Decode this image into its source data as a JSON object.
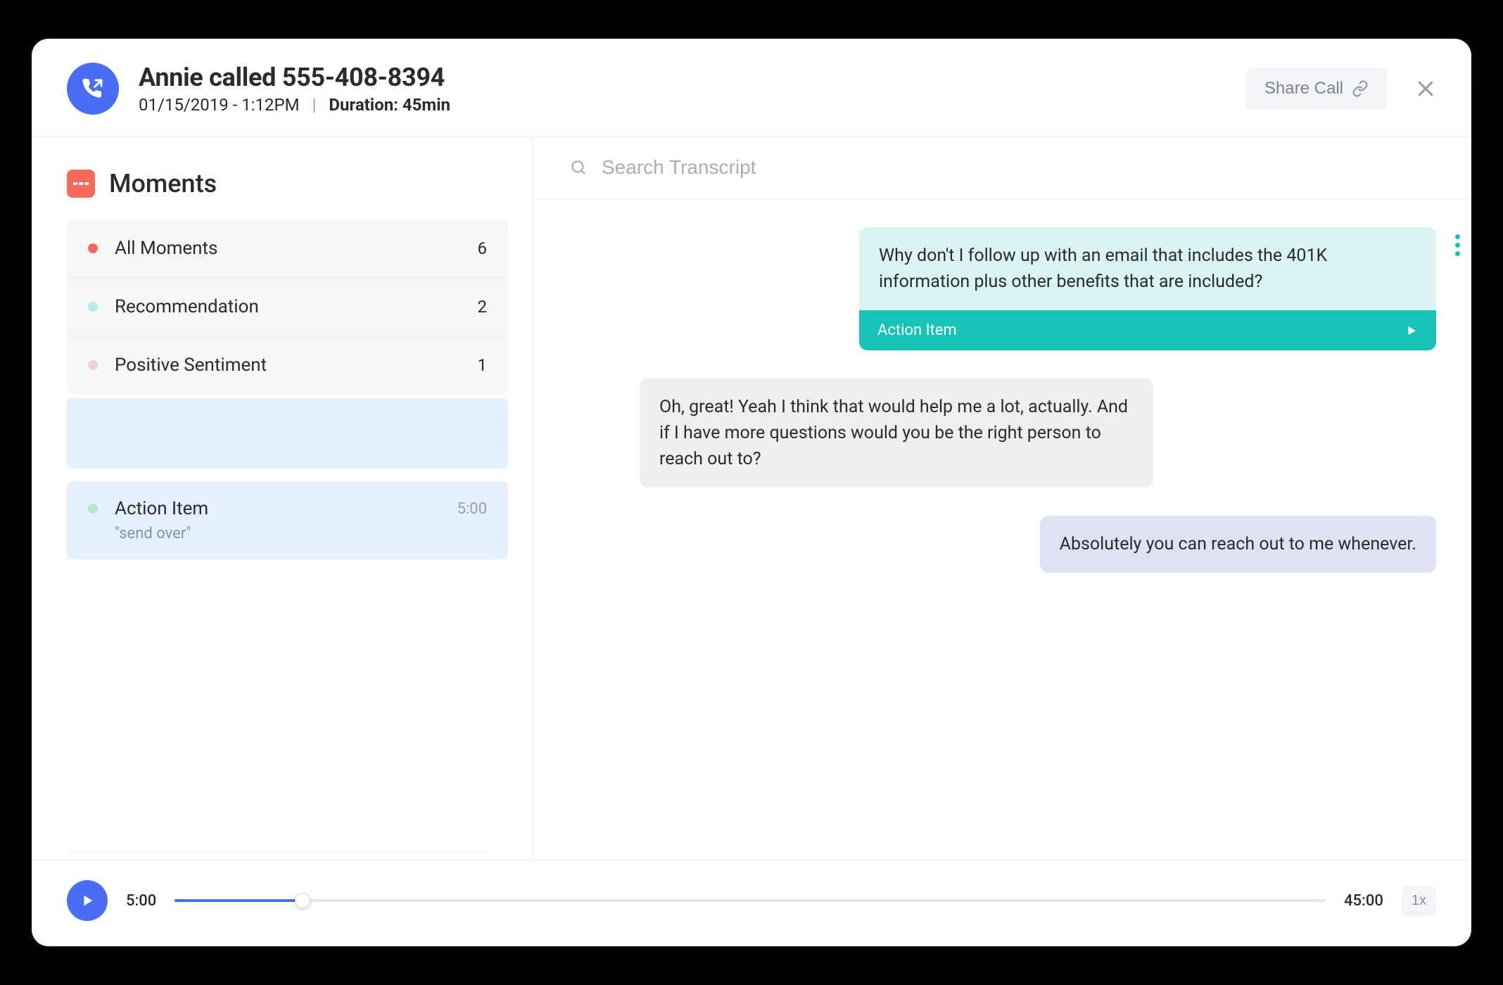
{
  "header": {
    "title": "Annie called 555-408-8394",
    "date": "01/15/2019 - 1:12PM",
    "duration_label": "Duration:",
    "duration_value": "45min",
    "share_label": "Share Call"
  },
  "sidebar": {
    "title": "Moments",
    "filters": [
      {
        "label": "All Moments",
        "count": "6",
        "color": "#f96a5d"
      },
      {
        "label": "Recommendation",
        "count": "2",
        "color": "#b9e9e6"
      },
      {
        "label": "Positive Sentiment",
        "count": "1",
        "color": "#f9cfe0"
      }
    ],
    "moment": {
      "dot_color": "#b6e6c8",
      "label": "Action Item",
      "time": "5:00",
      "snippet": "\"send over\""
    }
  },
  "search": {
    "placeholder": "Search Transcript"
  },
  "transcript": {
    "msg1": "Why don't I follow up with an email that includes the 401K information plus other benefits that are included?",
    "msg1_tag": "Action Item",
    "msg2": "Oh, great! Yeah I think that would help me a lot, actually. And if I have more questions would you be the right person to reach out to?",
    "msg3": "Absolutely you can reach out to me whenever."
  },
  "player": {
    "current": "5:00",
    "total": "45:00",
    "speed": "1x"
  }
}
